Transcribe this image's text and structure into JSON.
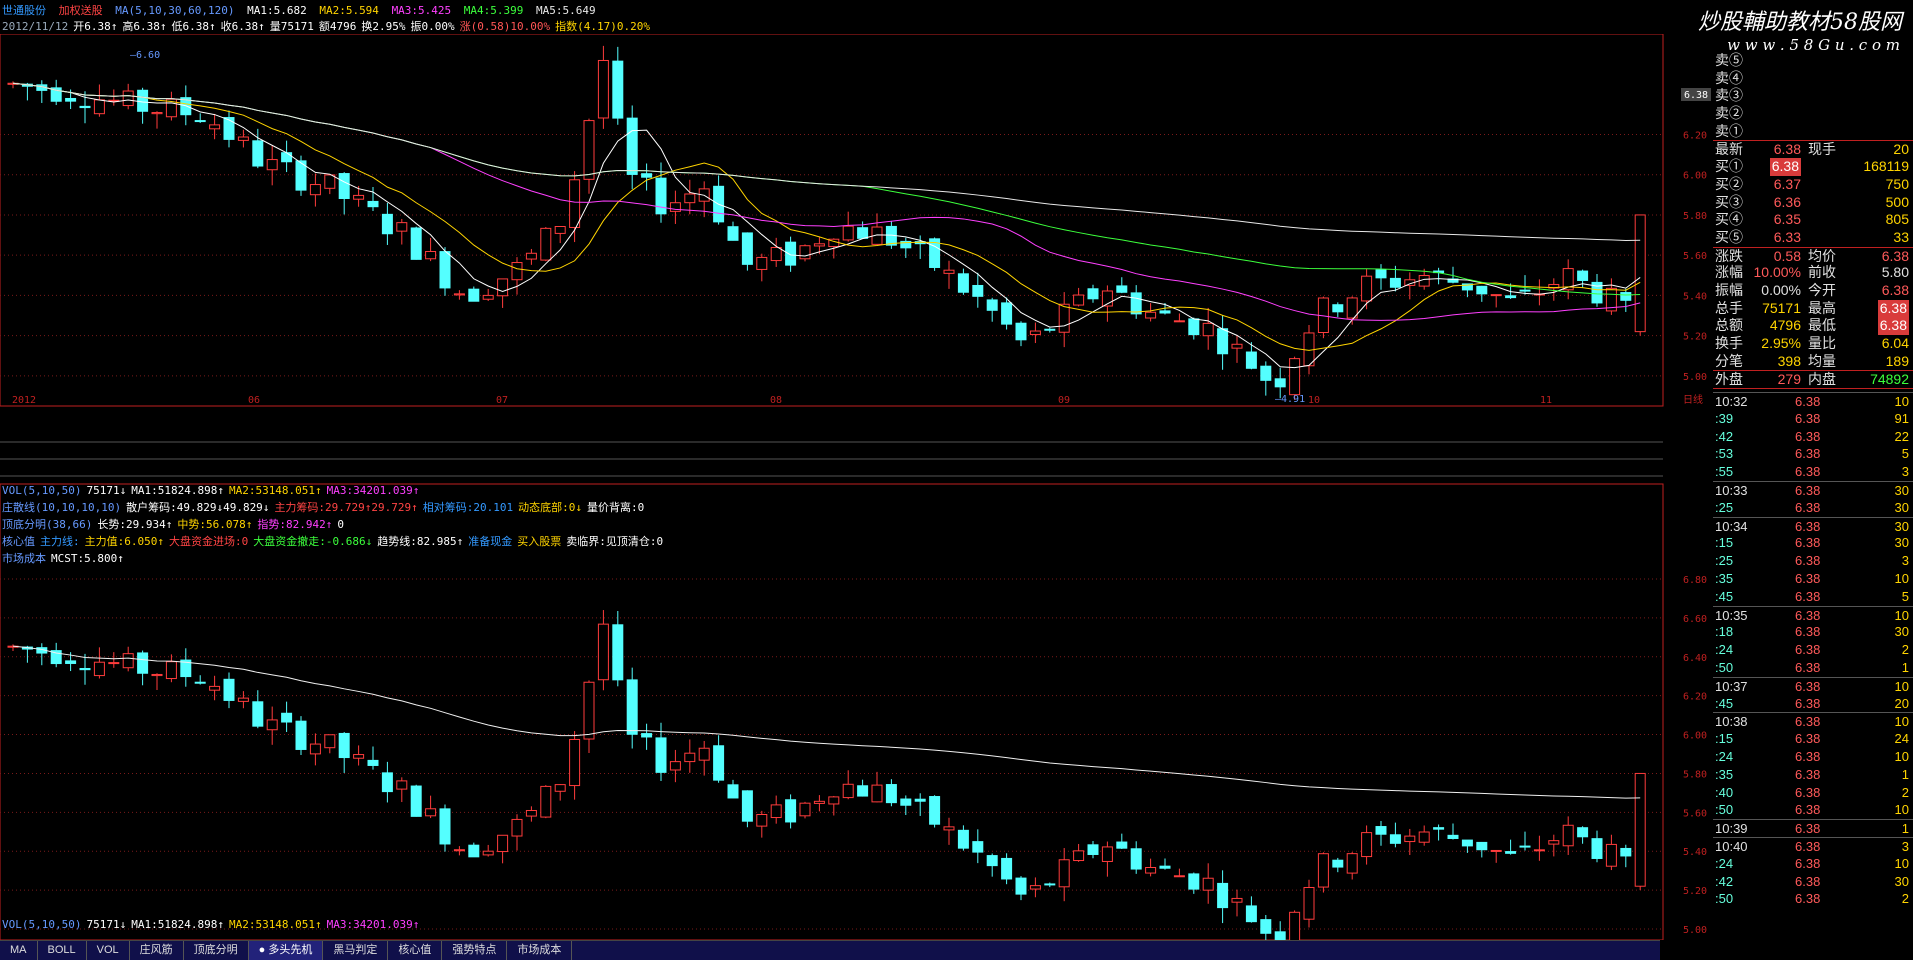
{
  "header": {
    "stock": "世通股份",
    "formula": "加权送股",
    "ma_params": "MA(5,10,30,60,120)",
    "ma_values": [
      {
        "label": "MA1:5.682",
        "color": "#ffffff"
      },
      {
        "label": "MA2:5.594",
        "color": "#ffd400"
      },
      {
        "label": "MA3:5.425",
        "color": "#ff40ff"
      },
      {
        "label": "MA4:5.399",
        "color": "#3cff3c"
      },
      {
        "label": "MA5:5.649",
        "color": "#e8e8e8"
      }
    ],
    "line2": [
      {
        "t": "2012/11/12",
        "c": "#9ab"
      },
      {
        "t": "开6.38↑",
        "c": "#fff"
      },
      {
        "t": "高6.38↑",
        "c": "#fff"
      },
      {
        "t": "低6.38↑",
        "c": "#fff"
      },
      {
        "t": "收6.38↑",
        "c": "#fff"
      },
      {
        "t": "量75171",
        "c": "#fff"
      },
      {
        "t": "额4796",
        "c": "#fff"
      },
      {
        "t": "换2.95%",
        "c": "#fff"
      },
      {
        "t": "振0.00%",
        "c": "#fff"
      },
      {
        "t": "涨(0.58)10.00%",
        "c": "#ff5555"
      },
      {
        "t": "指数(4.17)0.20%",
        "c": "#ffd400"
      }
    ]
  },
  "logo": {
    "title": "炒股輔助教材58股网",
    "url": "w w w . 5 8 G u . c o m"
  },
  "main_chart": {
    "y_ticks": [
      "6.20",
      "6.00",
      "5.80",
      "5.60",
      "5.40",
      "5.20",
      "5.00"
    ],
    "current_price_tag": "6.38",
    "high_label": "6.60",
    "low_label": "4.91",
    "x_labels": [
      "2012",
      "06",
      "07",
      "08",
      "09",
      "10",
      "11"
    ],
    "date_box": "日线"
  },
  "sub_headers": {
    "vol": [
      {
        "t": "VOL(5,10,50)",
        "c": "#6699ff"
      },
      {
        "t": "75171↓",
        "c": "#fff"
      },
      {
        "t": "MA1:51824.898↑",
        "c": "#fff"
      },
      {
        "t": "MA2:53148.051↑",
        "c": "#ffd400"
      },
      {
        "t": "MA3:34201.039↑",
        "c": "#ff40ff"
      }
    ],
    "zhuli": [
      {
        "t": "庄散线(10,10,10,10)",
        "c": "#6699ff"
      },
      {
        "t": "散户筹码:49.829↓49.829↓",
        "c": "#fff"
      },
      {
        "t": "主力筹码:29.729↑29.729↑",
        "c": "#ff4444"
      },
      {
        "t": "相对筹码:20.101",
        "c": "#3399ff"
      },
      {
        "t": "动态底部:0↓",
        "c": "#ffd400"
      },
      {
        "t": "量价背离:0",
        "c": "#fff"
      }
    ],
    "dingdi": [
      {
        "t": "顶底分明(38,66)",
        "c": "#6699ff"
      },
      {
        "t": "长势:29.934↑",
        "c": "#fff"
      },
      {
        "t": "中势:56.078↑",
        "c": "#ffd400"
      },
      {
        "t": "指势:82.942↑",
        "c": "#ff40ff"
      },
      {
        "t": "0",
        "c": "#fff"
      }
    ],
    "hexin": [
      {
        "t": "核心值",
        "c": "#6699ff"
      },
      {
        "t": "主力线:",
        "c": "#3399ff"
      },
      {
        "t": "主力值:6.050↑",
        "c": "#ffd400"
      },
      {
        "t": "大盘资金进场:0",
        "c": "#ff4444"
      },
      {
        "t": "大盘资金撤走:-0.686↓",
        "c": "#3cff3c"
      },
      {
        "t": "趋势线:82.985↑",
        "c": "#fff"
      },
      {
        "t": "准备现金",
        "c": "#3399ff"
      },
      {
        "t": "买入股票",
        "c": "#ffd400"
      },
      {
        "t": "卖临界:见顶清仓:0",
        "c": "#fff"
      }
    ],
    "mcst": [
      {
        "t": "市场成本",
        "c": "#6699ff"
      },
      {
        "t": "MCST:5.800↑",
        "c": "#fff"
      }
    ],
    "bottom_vol": [
      {
        "t": "VOL(5,10,50)",
        "c": "#6699ff"
      },
      {
        "t": "75171↓",
        "c": "#fff"
      },
      {
        "t": "MA1:51824.898↑",
        "c": "#fff"
      },
      {
        "t": "MA2:53148.051↑",
        "c": "#ffd400"
      },
      {
        "t": "MA3:34201.039↑",
        "c": "#ff40ff"
      }
    ]
  },
  "lower_chart": {
    "y_ticks": [
      "6.80",
      "6.60",
      "6.40",
      "6.20",
      "6.00",
      "5.80",
      "5.60",
      "5.40",
      "5.20",
      "5.00"
    ]
  },
  "tabs": [
    "MA",
    "BOLL",
    "VOL",
    "庄风筋",
    "顶底分明",
    "多头先机",
    "黑马判定",
    "核心值",
    "强势特点",
    "市场成本"
  ],
  "active_tab": 5,
  "quote_panel": {
    "sell": [
      {
        "label": "卖⑤"
      },
      {
        "label": "卖④"
      },
      {
        "label": "卖③"
      },
      {
        "label": "卖②"
      },
      {
        "label": "卖①"
      }
    ],
    "latest": {
      "label": "最新",
      "price": "6.38",
      "label2": "现手",
      "vol": "20"
    },
    "buy": [
      {
        "label": "买①",
        "price": "6.38",
        "vol": "168119",
        "hl": true
      },
      {
        "label": "买②",
        "price": "6.37",
        "vol": "750"
      },
      {
        "label": "买③",
        "price": "6.36",
        "vol": "500"
      },
      {
        "label": "买④",
        "price": "6.35",
        "vol": "805"
      },
      {
        "label": "买⑤",
        "price": "6.33",
        "vol": "33"
      }
    ],
    "stats": [
      {
        "a": "涨跌",
        "av": "0.58",
        "ac": "#ff5a5a",
        "b": "均价",
        "bv": "6.38",
        "bc": "#ff5a5a"
      },
      {
        "a": "涨幅",
        "av": "10.00%",
        "ac": "#ff5a5a",
        "b": "前收",
        "bv": "5.80",
        "bc": "#e0e0e0"
      },
      {
        "a": "振幅",
        "av": "0.00%",
        "ac": "#e0e0e0",
        "b": "今开",
        "bv": "6.38",
        "bc": "#ff5a5a"
      },
      {
        "a": "总手",
        "av": "75171",
        "ac": "#ffd400",
        "b": "最高",
        "bv": "6.38",
        "bc": "#ff5a5a",
        "hl": true
      },
      {
        "a": "总额",
        "av": "4796",
        "ac": "#ffd400",
        "b": "最低",
        "bv": "6.38",
        "bc": "#ff5a5a",
        "hl": true
      },
      {
        "a": "换手",
        "av": "2.95%",
        "ac": "#ffd400",
        "b": "量比",
        "bv": "6.04",
        "bc": "#ffd400"
      },
      {
        "a": "分笔",
        "av": "398",
        "ac": "#ffd400",
        "b": "均量",
        "bv": "189",
        "bc": "#ffd400"
      },
      {
        "a": "外盘",
        "av": "279",
        "ac": "#ff5a5a",
        "b": "内盘",
        "bv": "74892",
        "bc": "#3cff3c"
      }
    ],
    "ticks": [
      {
        "t": "10:32",
        "p": "6.38",
        "v": "10",
        "hm": true
      },
      {
        "t": ":39",
        "p": "6.38",
        "v": "91"
      },
      {
        "t": ":42",
        "p": "6.38",
        "v": "22"
      },
      {
        "t": ":53",
        "p": "6.38",
        "v": "5"
      },
      {
        "t": ":55",
        "p": "6.38",
        "v": "3"
      },
      {
        "t": "10:33",
        "p": "6.38",
        "v": "30",
        "hm": true
      },
      {
        "t": ":25",
        "p": "6.38",
        "v": "30"
      },
      {
        "t": "10:34",
        "p": "6.38",
        "v": "30",
        "hm": true
      },
      {
        "t": ":15",
        "p": "6.38",
        "v": "30"
      },
      {
        "t": ":25",
        "p": "6.38",
        "v": "3"
      },
      {
        "t": ":35",
        "p": "6.38",
        "v": "10"
      },
      {
        "t": ":45",
        "p": "6.38",
        "v": "5"
      },
      {
        "t": "10:35",
        "p": "6.38",
        "v": "10",
        "hm": true
      },
      {
        "t": ":18",
        "p": "6.38",
        "v": "30"
      },
      {
        "t": ":24",
        "p": "6.38",
        "v": "2"
      },
      {
        "t": ":50",
        "p": "6.38",
        "v": "1"
      },
      {
        "t": "10:37",
        "p": "6.38",
        "v": "10",
        "hm": true
      },
      {
        "t": ":45",
        "p": "6.38",
        "v": "20"
      },
      {
        "t": "10:38",
        "p": "6.38",
        "v": "10",
        "hm": true
      },
      {
        "t": ":15",
        "p": "6.38",
        "v": "24"
      },
      {
        "t": ":24",
        "p": "6.38",
        "v": "10"
      },
      {
        "t": ":35",
        "p": "6.38",
        "v": "1"
      },
      {
        "t": ":40",
        "p": "6.38",
        "v": "2"
      },
      {
        "t": ":50",
        "p": "6.38",
        "v": "10"
      },
      {
        "t": "10:39",
        "p": "6.38",
        "v": "1",
        "hm": true
      },
      {
        "t": "10:40",
        "p": "6.38",
        "v": "3",
        "hm": true
      },
      {
        "t": ":24",
        "p": "6.38",
        "v": "10"
      },
      {
        "t": ":42",
        "p": "6.38",
        "v": "30"
      },
      {
        "t": ":50",
        "p": "6.38",
        "v": "2"
      }
    ]
  },
  "colors": {
    "up": "#ff3c3c",
    "down": "#54ffff",
    "ma1": "#ffffff",
    "ma2": "#ffd400",
    "ma3": "#ff40ff",
    "ma4": "#3cff3c",
    "ma5": "#e8e8e8",
    "grid": "#7a1a1a",
    "axis": "#c02020"
  }
}
